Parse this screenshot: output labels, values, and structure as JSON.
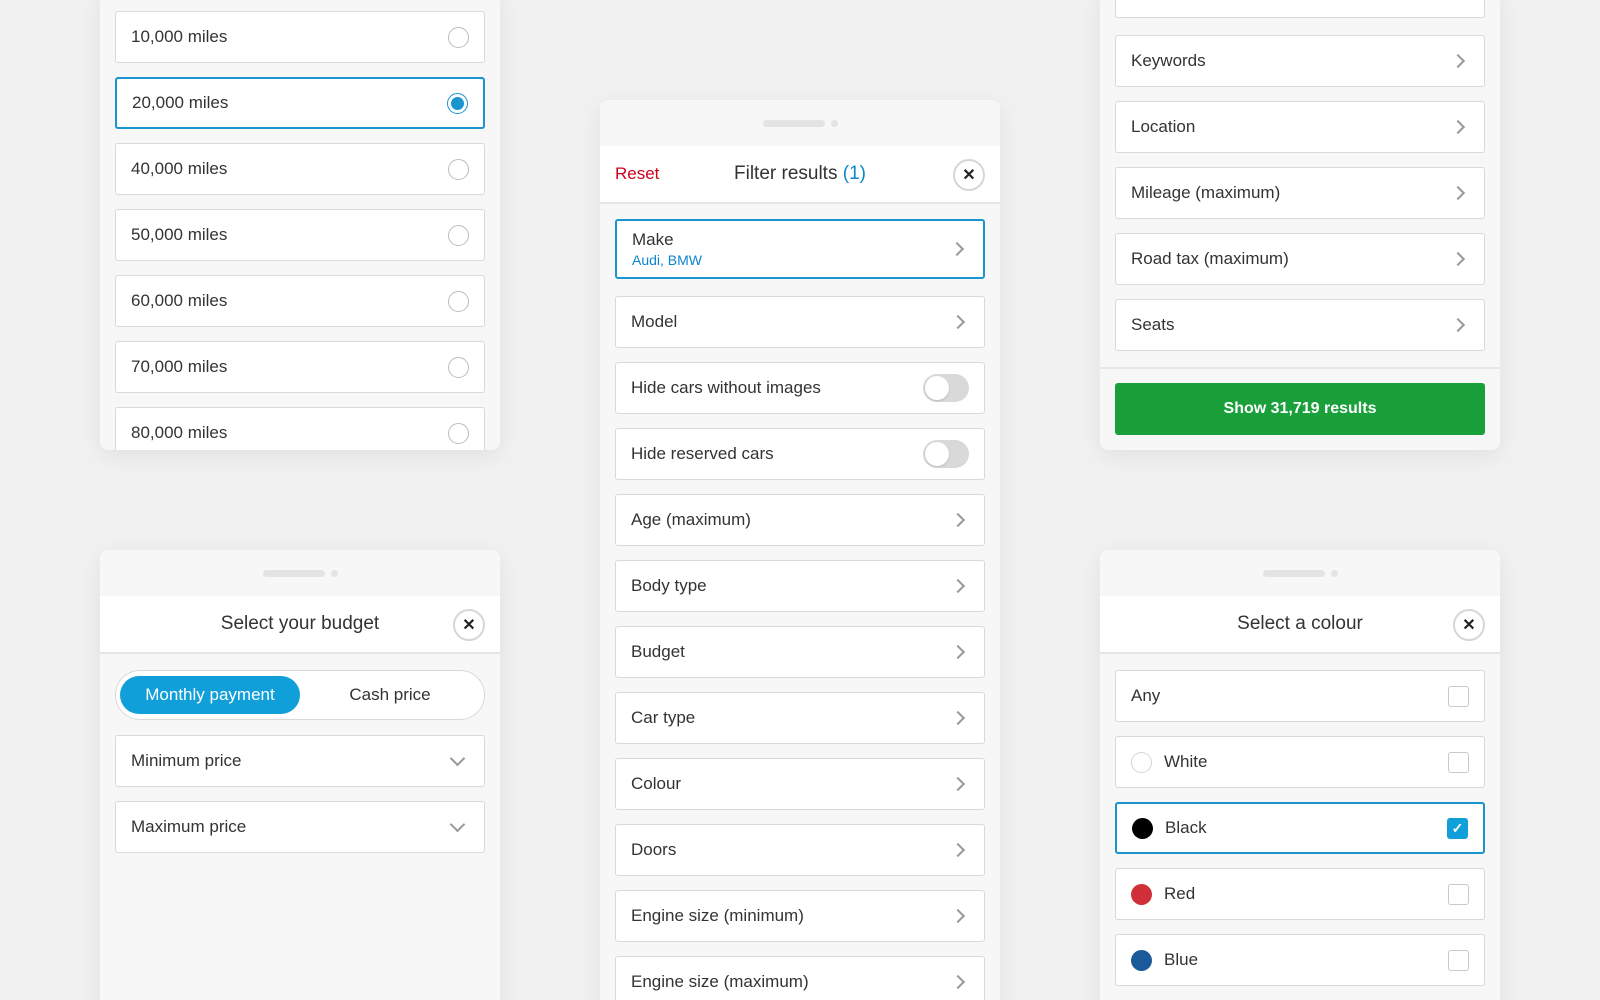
{
  "mileage_panel": {
    "options": [
      {
        "label": "10,000 miles",
        "selected": false
      },
      {
        "label": "20,000 miles",
        "selected": true
      },
      {
        "label": "40,000 miles",
        "selected": false
      },
      {
        "label": "50,000 miles",
        "selected": false
      },
      {
        "label": "60,000 miles",
        "selected": false
      },
      {
        "label": "70,000 miles",
        "selected": false
      },
      {
        "label": "80,000 miles",
        "selected": false
      }
    ]
  },
  "filter_panel": {
    "reset": "Reset",
    "title": "Filter results",
    "count": "(1)",
    "close": "✕",
    "make": {
      "label": "Make",
      "value": "Audi, BMW"
    },
    "model": "Model",
    "hide_no_images": "Hide cars without images",
    "hide_reserved": "Hide reserved cars",
    "items": [
      "Age (maximum)",
      "Body type",
      "Budget",
      "Car type",
      "Colour",
      "Doors",
      "Engine size (minimum)",
      "Engine size (maximum)"
    ]
  },
  "more_filters_panel": {
    "items": [
      "Keywords",
      "Location",
      "Mileage (maximum)",
      "Road tax (maximum)",
      "Seats"
    ],
    "cta": "Show 31,719 results"
  },
  "budget_panel": {
    "title": "Select your budget",
    "close": "✕",
    "tabs": [
      {
        "label": "Monthly payment",
        "selected": true
      },
      {
        "label": "Cash price",
        "selected": false
      }
    ],
    "min": "Minimum price",
    "max": "Maximum price"
  },
  "colour_panel": {
    "title": "Select a colour",
    "close": "✕",
    "any": "Any",
    "colours": [
      {
        "label": "White",
        "swatch": "#ffffff",
        "checked": false
      },
      {
        "label": "Black",
        "swatch": "#000000",
        "checked": true
      },
      {
        "label": "Red",
        "swatch": "#d0303a",
        "checked": false
      },
      {
        "label": "Blue",
        "swatch": "#1a5a9a",
        "checked": false
      }
    ],
    "check_mark": "✓"
  }
}
